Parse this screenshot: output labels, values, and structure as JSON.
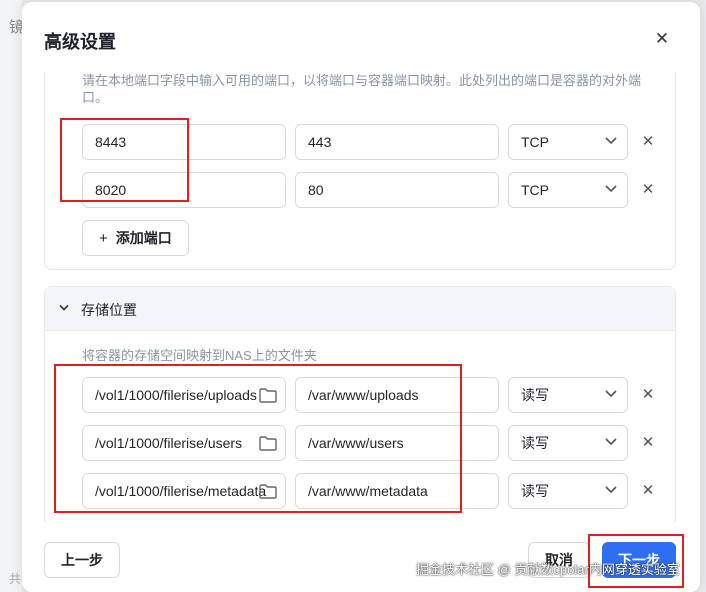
{
  "background": {
    "left_char_top": "镜",
    "left_char_bottom": "共"
  },
  "dialog": {
    "title": "高级设置",
    "close_icon": "close-icon"
  },
  "ports": {
    "hint": "请在本地端口字段中输入可用的端口，以将端口与容器端口映射。此处列出的端口是容器的对外端口。",
    "rows": [
      {
        "local": "8443",
        "container": "443",
        "protocol": "TCP"
      },
      {
        "local": "8020",
        "container": "80",
        "protocol": "TCP"
      }
    ],
    "add_label": "添加端口"
  },
  "storage": {
    "section_label": "存储位置",
    "hint": "将容器的存储空间映射到NAS上的文件夹",
    "rows": [
      {
        "host_path": "/vol1/1000/filerise/uploads",
        "container_path": "/var/www/uploads",
        "mode": "读写"
      },
      {
        "host_path": "/vol1/1000/filerise/users",
        "container_path": "/var/www/users",
        "mode": "读写"
      },
      {
        "host_path": "/vol1/1000/filerise/metadata",
        "container_path": "/var/www/metadata",
        "mode": "读写"
      }
    ]
  },
  "footer": {
    "prev_label": "上一步",
    "cancel_label": "取消",
    "next_label": "下一步"
  },
  "watermark": "掘金技术社区 @ 贡献数cpolar内网穿透实验室",
  "colors": {
    "primary": "#2f6ef2",
    "annotation": "#e02020"
  }
}
